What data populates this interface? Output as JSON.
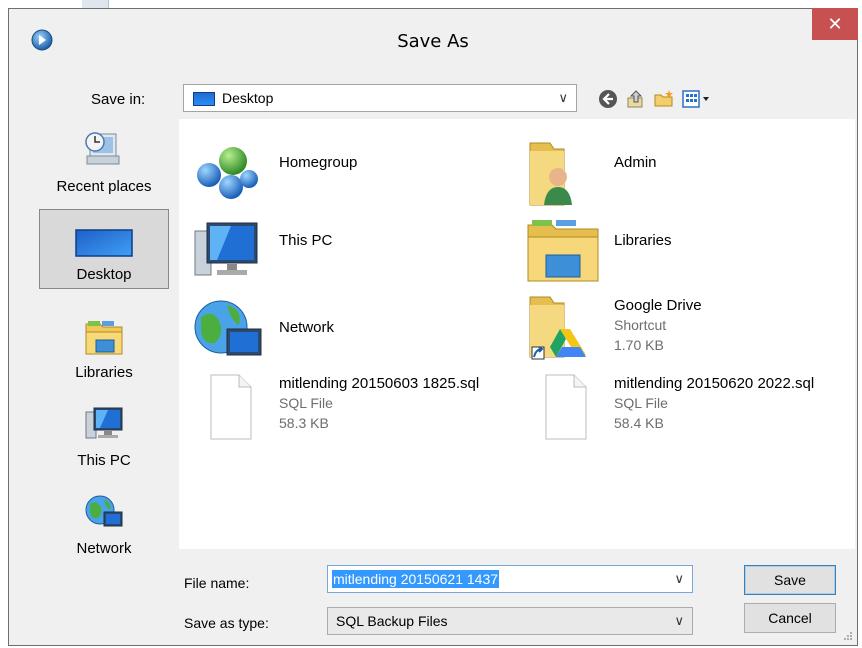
{
  "window": {
    "title": "Save As",
    "close_glyph": "✕",
    "accent": "#c75050"
  },
  "toolbar": {
    "save_in_label": "Save in:",
    "save_in_value": "Desktop",
    "icons": [
      "back-icon",
      "up-folder-icon",
      "new-folder-icon",
      "view-menu-icon"
    ]
  },
  "places": [
    {
      "label": "Recent places",
      "icon": "recent-places-icon"
    },
    {
      "label": "Desktop",
      "icon": "desktop-icon",
      "selected": true
    },
    {
      "label": "Libraries",
      "icon": "libraries-icon"
    },
    {
      "label": "This PC",
      "icon": "this-pc-icon"
    },
    {
      "label": "Network",
      "icon": "network-icon"
    }
  ],
  "items": [
    {
      "name": "Homegroup",
      "icon": "homegroup-icon"
    },
    {
      "name": "Admin",
      "icon": "user-folder-icon"
    },
    {
      "name": "This PC",
      "icon": "this-pc-icon"
    },
    {
      "name": "Libraries",
      "icon": "libraries-icon"
    },
    {
      "name": "Network",
      "icon": "network-icon"
    },
    {
      "name": "Google Drive",
      "type": "Shortcut",
      "size": "1.70 KB",
      "icon": "google-drive-shortcut-icon"
    },
    {
      "name": "mitlending 20150603 1825.sql",
      "type": "SQL File",
      "size": "58.3 KB",
      "icon": "file-icon"
    },
    {
      "name": "mitlending 20150620 2022.sql",
      "type": "SQL File",
      "size": "58.4 KB",
      "icon": "file-icon"
    }
  ],
  "form": {
    "file_name_label": "File name:",
    "file_name_value": "mitlending 20150621 1437",
    "save_type_label": "Save as type:",
    "save_type_value": "SQL Backup Files",
    "dropdown_arrow": "∨"
  },
  "buttons": {
    "save": "Save",
    "cancel": "Cancel"
  }
}
